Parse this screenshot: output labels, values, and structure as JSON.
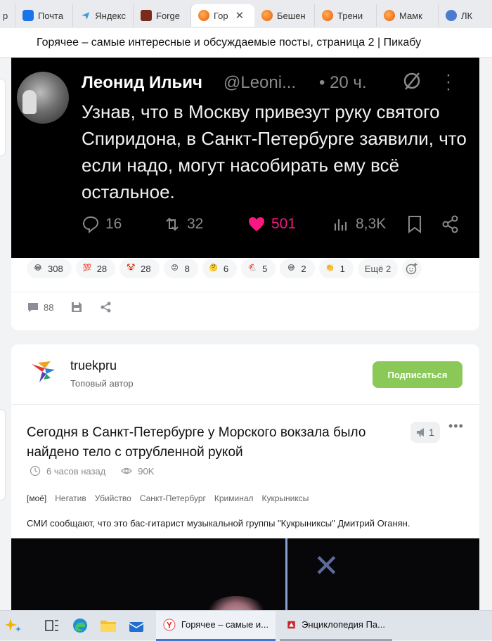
{
  "browser": {
    "tabs": [
      {
        "label": "р",
        "icon": "none"
      },
      {
        "label": "Почта",
        "icon": "mail-icon"
      },
      {
        "label": "Яндекс",
        "icon": "yandex-icon"
      },
      {
        "label": "Forge",
        "icon": "forge-icon"
      },
      {
        "label": "Гор",
        "icon": "pikabu-icon",
        "active": true,
        "close": "✕"
      },
      {
        "label": "Бешен",
        "icon": "pikabu-icon"
      },
      {
        "label": "Трени",
        "icon": "pikabu-icon"
      },
      {
        "label": "Мамк",
        "icon": "pikabu-icon"
      },
      {
        "label": "ЛК",
        "icon": "lk-icon"
      }
    ],
    "page_title": "Горячее – самые интересные и обсуждаемые посты, страница 2 | Пикабу"
  },
  "post1": {
    "tweet": {
      "name": "Леонид Ильич",
      "handle": "@Leoni...",
      "time": "• 20 ч.",
      "text": "Узнав, что в Москву привезут руку святого Спиридона, в Санкт-Петербурге заявили, что если надо, могут насобирать ему всё остальное.",
      "replies": "16",
      "retweets": "32",
      "likes": "501",
      "views": "8,3K"
    },
    "reactions": [
      {
        "emoji": "😂",
        "count": "308"
      },
      {
        "emoji": "💯",
        "count": "28"
      },
      {
        "emoji": "🤡",
        "count": "28"
      },
      {
        "emoji": "😡",
        "count": "8"
      },
      {
        "emoji": "🤔",
        "count": "6"
      },
      {
        "emoji": "🐔",
        "count": "5"
      },
      {
        "emoji": "😅",
        "count": "2"
      },
      {
        "emoji": "👏",
        "count": "1"
      }
    ],
    "reactions_more": "Ещё 2",
    "comments_count": "88",
    "colors": {
      "heart": "#f91880",
      "tweet_bg": "#000000"
    }
  },
  "post2": {
    "author": "truekpru",
    "author_status": "Топовый автор",
    "subscribe_label": "Подписаться",
    "title": "Сегодня в Санкт-Петербурге у Морского вокзала было найдено тело с отрубленной рукой",
    "rating": "1",
    "time_ago": "6 часов назад",
    "views": "90K",
    "tags": [
      "[моё]",
      "Негатив",
      "Убийство",
      "Санкт-Петербург",
      "Криминал",
      "Кукрыниксы"
    ],
    "text": "СМИ сообщают, что это бас-гитарист музыкальной группы \"Кукрыниксы\" Дмитрий Оганян.",
    "colors": {
      "subscribe": "#8ac858"
    }
  },
  "taskbar": {
    "apps": [
      {
        "label": "Горячее – самые и...",
        "icon": "yandex-browser-icon",
        "active": true
      },
      {
        "label": "Энциклопедия Па...",
        "icon": "encyclopedia-icon"
      }
    ]
  }
}
